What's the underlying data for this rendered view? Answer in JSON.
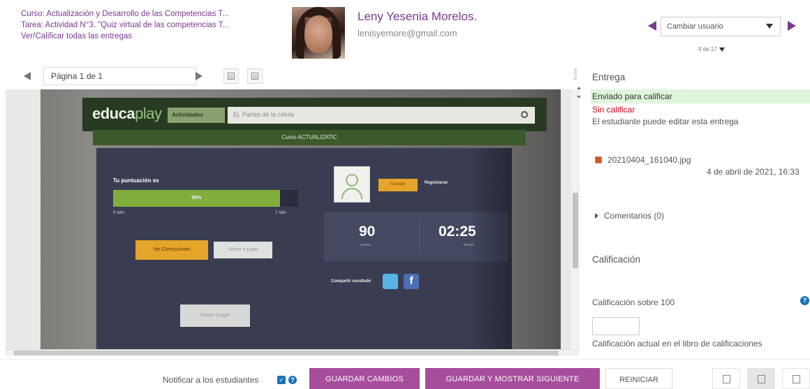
{
  "header": {
    "course_line": "Curso: Actualización y Desarrollo de las Competencias T...",
    "task_line": "Tarea: Actividad N°3. \"Quiz virtual de las competencias T...",
    "view_all_link": "Ver/Calificar todas las entregas",
    "user_name": "Leny Yesenia Morelos.",
    "user_email": "lenisyemore@gmail.com",
    "change_user_placeholder": "Cambiar usuario",
    "user_count": "9 de 17"
  },
  "toolbar": {
    "page_label": "Página 1 de 1"
  },
  "document": {
    "site_logo_main": "educa",
    "site_logo_rest": "play",
    "activities_tab": "Actividades",
    "search_placeholder": "Ej. Partes de la célula",
    "course_banner": "Curso ACTUALIZATIC",
    "score_label": "Tu puntuación es",
    "score_value_text": "90%",
    "score_fraction": 0.9,
    "score_min": "0 fallo",
    "score_max": "1 fallo",
    "view_corrections": "Ver Correcciones",
    "play_again_1": "Volver a jugar",
    "play_again_2": "Volver a jugar",
    "login_button": "Acceder",
    "register_link": "Registrarse",
    "stat_points": "90",
    "stat_points_label": "puntos",
    "stat_time": "02:25",
    "stat_time_label": "tiempo",
    "share_label": "Compartir resultado",
    "fb_glyph": "f"
  },
  "side": {
    "title": "Entrega",
    "status_submitted": "Enviado para calificar",
    "status_ungraded": "Sin calificar",
    "status_editable": "El estudiante puede editar esta entrega",
    "file_name": "20210404_161040.jpg",
    "file_date": "4 de abril de 2021, 16:33",
    "comments": "Comentarios (0)",
    "grade_title": "Calificación",
    "grade_label": "Calificación sobre 100",
    "grade_value": "",
    "gradebook_label": "Calificación actual en el libro de calificaciones"
  },
  "footer": {
    "notify_label": "Notificar a los estudiantes",
    "save_button": "GUARDAR CAMBIOS",
    "save_next_button": "GUARDAR Y MOSTRAR SIGUIENTE",
    "reset_button": "REINICIAR"
  },
  "colors": {
    "accent": "#7a3a8e",
    "button_purple": "#a64d9b",
    "status_green_bg": "#dff5dc",
    "status_red": "#d9001b",
    "help_blue": "#1a73b8"
  }
}
